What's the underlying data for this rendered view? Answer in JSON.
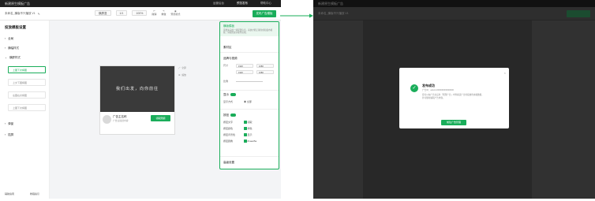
{
  "left": {
    "titlebar": {
      "title": "新建原生模板广告",
      "tab1": "运营后台",
      "tab2": "预览发布",
      "tab3": "帮助中心"
    },
    "toolbar": {
      "doc_title": "未命名_横版不兴播放 V1",
      "device": "横屏竖",
      "zoom": "100%",
      "page": "1/1",
      "btn_undo": "撤销",
      "btn_redo": "重做",
      "btn_preview": "预览模式",
      "publish": "发布广告模板"
    },
    "sidebar": {
      "title": "投放模板设置",
      "items": [
        {
          "label": "全局"
        },
        {
          "label": "横幅样式"
        },
        {
          "label": "横屏样式"
        }
      ],
      "subitems": [
        {
          "label": "上图下文横图"
        },
        {
          "label": "上文下图横图"
        },
        {
          "label": "左图右文横图"
        },
        {
          "label": "上图下文横图"
        }
      ],
      "items2": [
        {
          "label": "弹窗"
        },
        {
          "label": "插屏"
        }
      ],
      "footer_left": "辅助指南",
      "footer_right": "教程指引"
    },
    "canvas": {
      "video_text": "我们出发，向你前往",
      "ad_name": "广告主名称",
      "ad_sub": "广告主描述内容",
      "ad_button": "领取限额",
      "float1": "全屏",
      "float2": "缩放"
    },
    "panel": {
      "header": "横版模板",
      "hint": "需要先完成一些配置信息，系统才能正确生成和发布模板，请按照提示操作完成。",
      "sec1": "素材区",
      "sec2": "品牌与视频",
      "row_size": "尺寸",
      "row_ratio": "比例",
      "v1": "1920",
      "v2": "1080",
      "v3": "1920",
      "v4": "1080",
      "sec3": "显示",
      "row_mode": "显示方式",
      "mode_val": "全部",
      "sec4": "按钮",
      "cb1": "按钮文字",
      "cb1v": "领取",
      "cb2": "按钮颜色",
      "cb2v": "绿色",
      "cb3": "按钮背景色",
      "cb3v": "显示",
      "cb4": "按钮圆角",
      "cb4v": "#1aad5a",
      "footer": "高级设置"
    }
  },
  "right": {
    "titlebar": {
      "title": "新建原生模板广告"
    },
    "toolbar": {
      "doc_title": "未命名_横版不兴播放 V1"
    },
    "dialog": {
      "title": "发布成功",
      "line1": "广告ID：adunit-000000000000000",
      "line2": "您可以在广告主后台「管理广告」中查看该广告的投放状态和数据，并可随时编辑广告内容。",
      "button": "前往广告管理",
      "close": "×"
    }
  },
  "colors": {
    "accent": "#1aad5a"
  }
}
